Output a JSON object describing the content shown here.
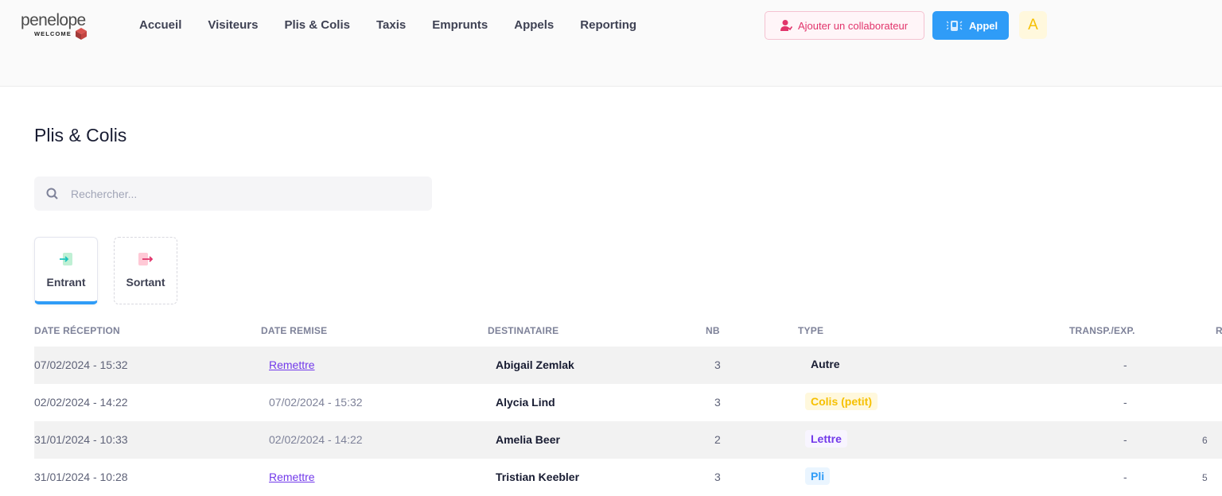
{
  "logo": {
    "word": "penelope",
    "sub": "WELCOME"
  },
  "nav": [
    "Accueil",
    "Visiteurs",
    "Plis & Colis",
    "Taxis",
    "Emprunts",
    "Appels",
    "Reporting"
  ],
  "header": {
    "add_label": "Ajouter un collaborateur",
    "call_label": "Appel",
    "avatar": "A"
  },
  "page": {
    "title": "Plis & Colis"
  },
  "search": {
    "placeholder": "Rechercher..."
  },
  "tabs": [
    {
      "label": "Entrant",
      "active": true
    },
    {
      "label": "Sortant",
      "active": false
    }
  ],
  "table": {
    "columns": [
      "DATE RÉCEPTION",
      "DATE REMISE",
      "DESTINATAIRE",
      "NB",
      "TYPE",
      "TRANSP./EXP.",
      "R"
    ],
    "rows": [
      {
        "date": "07/02/2024 - 15:32",
        "remise": "Remettre",
        "dest": "Abigail Zemlak",
        "nb": "3",
        "type": "Autre",
        "transp": "-",
        "r": ""
      },
      {
        "date": "02/02/2024 - 14:22",
        "remise": "07/02/2024 - 15:32",
        "dest": "Alycia Lind",
        "nb": "3",
        "type": "Colis (petit)",
        "transp": "-",
        "r": ""
      },
      {
        "date": "31/01/2024 - 10:33",
        "remise": "02/02/2024 - 14:22",
        "dest": "Amelia Beer",
        "nb": "2",
        "type": "Lettre",
        "transp": "-",
        "r": "6"
      },
      {
        "date": "31/01/2024 - 10:28",
        "remise": "Remettre",
        "dest": "Tristian Keebler",
        "nb": "3",
        "type": "Pli",
        "transp": "-",
        "r": "5"
      }
    ]
  },
  "colors": {
    "accent": "#2f9cf7",
    "link": "#7239ea",
    "danger": "#e1346b",
    "warning": "#f6c000"
  }
}
